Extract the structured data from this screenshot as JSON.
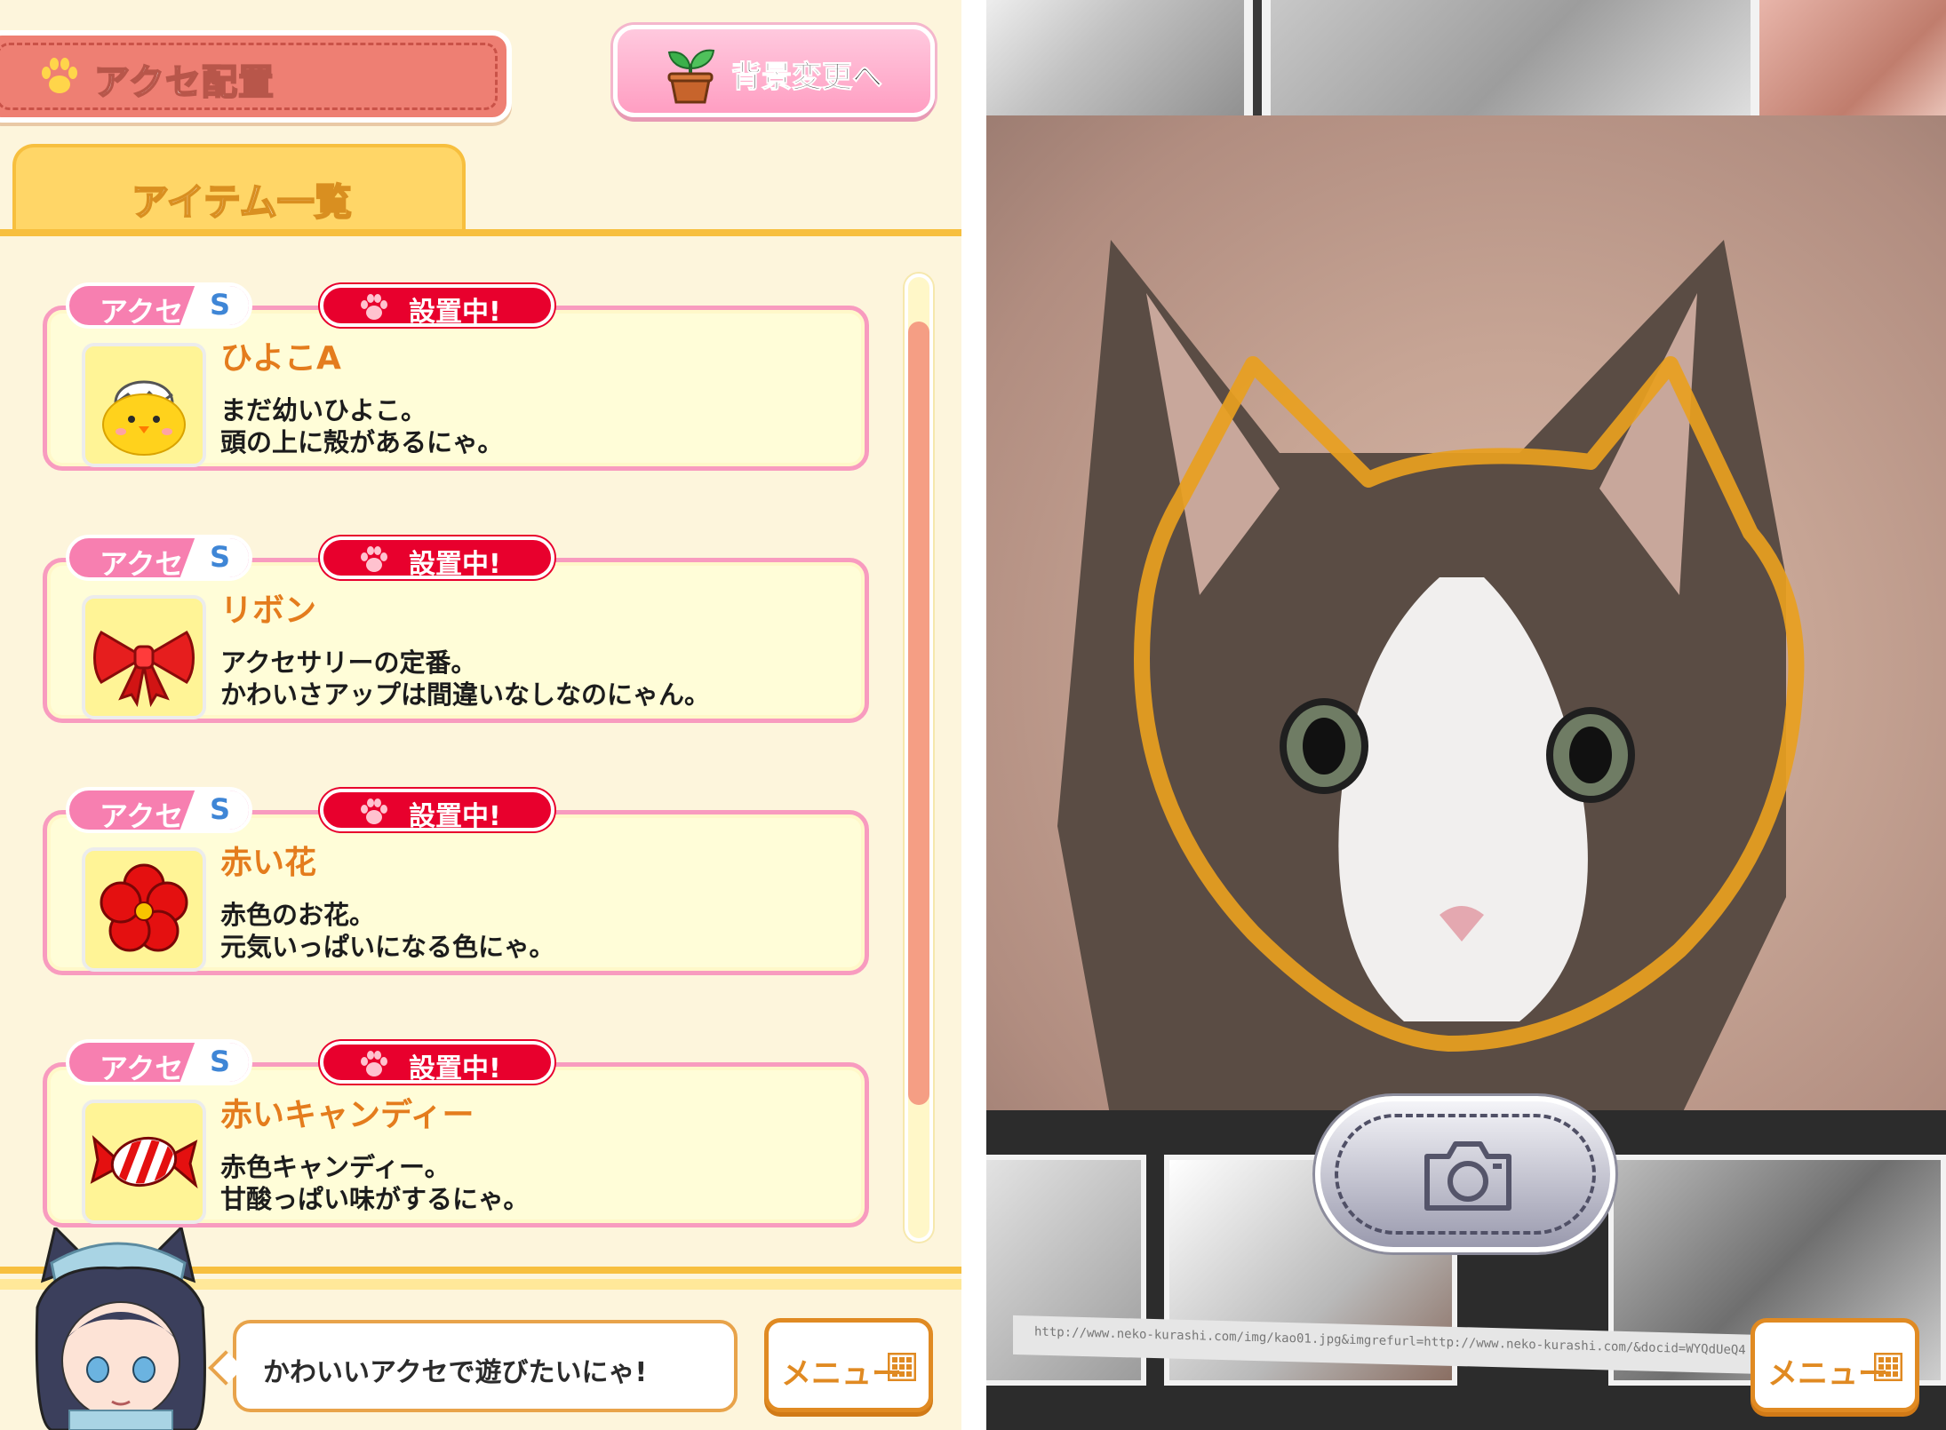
{
  "left_panel": {
    "header": {
      "title": "アクセ配置",
      "background_button": "背景変更へ"
    },
    "list_tab": "アイテム一覧",
    "items": [
      {
        "category": "アクセ",
        "size": "S",
        "status": "設置中!",
        "name": "ひよこA",
        "desc_line1": "まだ幼いひよこ。",
        "desc_line2": "頭の上に殻があるにゃ。",
        "icon": "chick-icon"
      },
      {
        "category": "アクセ",
        "size": "S",
        "status": "設置中!",
        "name": "リボン",
        "desc_line1": "アクセサリーの定番。",
        "desc_line2": "かわいさアップは間違いなしなのにゃん。",
        "icon": "ribbon-icon"
      },
      {
        "category": "アクセ",
        "size": "S",
        "status": "設置中!",
        "name": "赤い花",
        "desc_line1": "赤色のお花。",
        "desc_line2": "元気いっぱいになる色にゃ。",
        "icon": "red-flower-icon"
      },
      {
        "category": "アクセ",
        "size": "S",
        "status": "設置中!",
        "name": "赤いキャンディー",
        "desc_line1": "赤色キャンディー。",
        "desc_line2": "甘酸っぱい味がするにゃ。",
        "icon": "red-candy-icon"
      }
    ],
    "scroll_position": 0.25,
    "speech": "かわいいアクセで遊びたいにゃ!",
    "menu_button": "メニュー"
  },
  "right_panel": {
    "url_text": "http://www.neko-kurashi.com/img/kao01.jpg&imgrefurl=http://www.neko-kurashi.com/&docid=WYQdUeQ4",
    "menu_button": "メニュー",
    "camera_icon": "camera-icon",
    "face_guide_icon": "cat-face-outline"
  },
  "colors": {
    "panel_bg": "#fdf5dc",
    "accent_pink": "#f89bbf",
    "status_red": "#e8002d",
    "name_orange": "#e47c1d",
    "guide_orange": "#e8a020"
  }
}
